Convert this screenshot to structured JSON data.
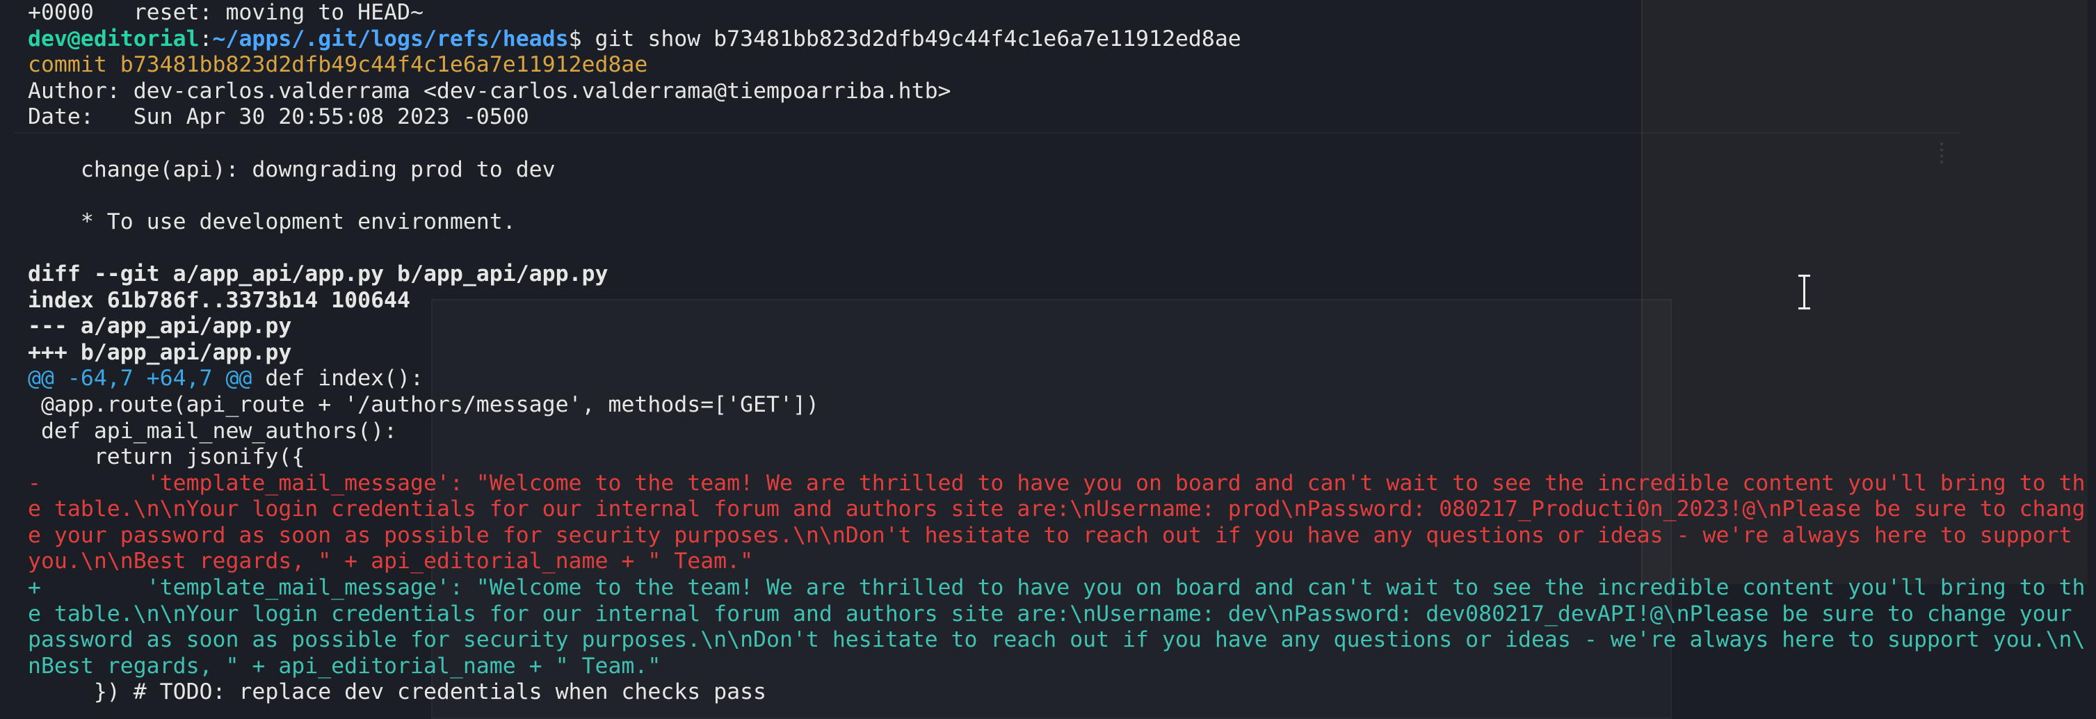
{
  "terminal": {
    "line_0": "+0000   reset: moving to HEAD~",
    "prompt": {
      "user_host": "dev@editorial",
      "separator": ":",
      "path": "~/apps/.git/logs/refs/heads",
      "symbol": "$",
      "command": " git show b73481bb823d2dfb49c44f4c1e6a7e11912ed8ae"
    },
    "commit_line": "commit b73481bb823d2dfb49c44f4c1e6a7e11912ed8ae",
    "author_line": "Author: dev-carlos.valderrama <dev-carlos.valderrama@tiempoarriba.htb>",
    "date_line": "Date:   Sun Apr 30 20:55:08 2023 -0500",
    "message_title": "    change(api): downgrading prod to dev",
    "message_body": "    * To use development environment.",
    "diff_header": "diff --git a/app_api/app.py b/app_api/app.py",
    "index_line": "index 61b786f..3373b14 100644",
    "old_file": "--- a/app_api/app.py",
    "new_file": "+++ b/app_api/app.py",
    "hunk": {
      "marker": "@@ -64,7 +64,7 @@",
      "context": " def index():"
    },
    "context_lines": [
      " @app.route(api_route + '/authors/message', methods=['GET'])",
      " def api_mail_new_authors():",
      "     return jsonify({"
    ],
    "removed_lines": [
      "-        'template_mail_message': \"Welcome to the team! We are thrilled to have you on board and can't wait to see the incredible content you'll bring to th",
      "e table.\\n\\nYour login credentials for our internal forum and authors site are:\\nUsername: prod\\nPassword: 080217_Producti0n_2023!@\\nPlease be sure to chang",
      "e your password as soon as possible for security purposes.\\n\\nDon't hesitate to reach out if you have any questions or ideas - we're always here to support",
      "you.\\n\\nBest regards, \" + api_editorial_name + \" Team.\""
    ],
    "added_lines": [
      "+        'template_mail_message': \"Welcome to the team! We are thrilled to have you on board and can't wait to see the incredible content you'll bring to th",
      "e table.\\n\\nYour login credentials for our internal forum and authors site are:\\nUsername: dev\\nPassword: dev080217_devAPI!@\\nPlease be sure to change your",
      "password as soon as possible for security purposes.\\n\\nDon't hesitate to reach out if you have any questions or ideas - we're always here to support you.\\n\\",
      "nBest regards, \" + api_editorial_name + \" Team.\""
    ],
    "closing_line": "     }) # TODO: replace dev credentials when checks pass"
  },
  "colors": {
    "background": "#1b1e24",
    "prompt_user": "#26d4a3",
    "prompt_path": "#4da6ff",
    "commit": "#d9a441",
    "hunk": "#3aa7e6",
    "removed": "#e23e3e",
    "added": "#3fc2b4",
    "text": "#e6e6e6"
  },
  "icons": {
    "cursor": "text-cursor-ibeam-icon"
  }
}
